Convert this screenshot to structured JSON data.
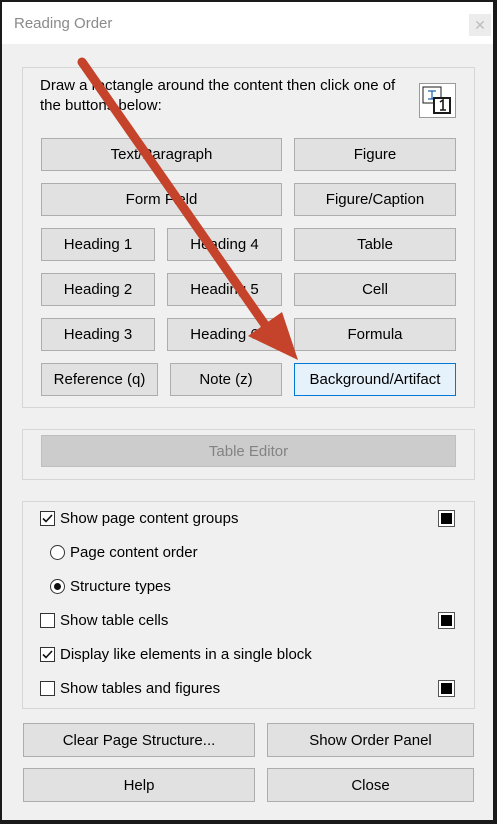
{
  "window": {
    "title": "Reading Order",
    "close_glyph": "✕"
  },
  "instructions": "Draw a rectangle around the content then click one of the buttons below:",
  "tag_buttons": {
    "text_paragraph": "Text/Paragraph",
    "figure": "Figure",
    "form_field": "Form Field",
    "figure_caption": "Figure/Caption",
    "heading1": "Heading 1",
    "heading4": "Heading 4",
    "table": "Table",
    "heading2": "Heading 2",
    "heading5": "Heading 5",
    "cell": "Cell",
    "heading3": "Heading 3",
    "heading6": "Heading 6",
    "formula": "Formula",
    "reference": "Reference (q)",
    "note": "Note (z)",
    "background_artifact": "Background/Artifact"
  },
  "table_editor": "Table Editor",
  "options": {
    "show_page_content_groups": {
      "label": "Show page content groups",
      "checked": true
    },
    "page_content_order": {
      "label": "Page content order",
      "selected": false
    },
    "structure_types": {
      "label": "Structure types",
      "selected": true
    },
    "show_table_cells": {
      "label": "Show table cells",
      "checked": false
    },
    "display_like_elements": {
      "label": "Display like elements in a single block",
      "checked": true
    },
    "show_tables_figures": {
      "label": "Show tables and figures",
      "checked": false
    }
  },
  "footer": {
    "clear_page_structure": "Clear Page Structure...",
    "show_order_panel": "Show Order Panel",
    "help": "Help",
    "close": "Close"
  },
  "colors": {
    "arrow": "#c5432a",
    "active_border": "#0078d7",
    "swatch": "#000000"
  },
  "icons": {
    "reading_order": "reading-order-icon"
  }
}
